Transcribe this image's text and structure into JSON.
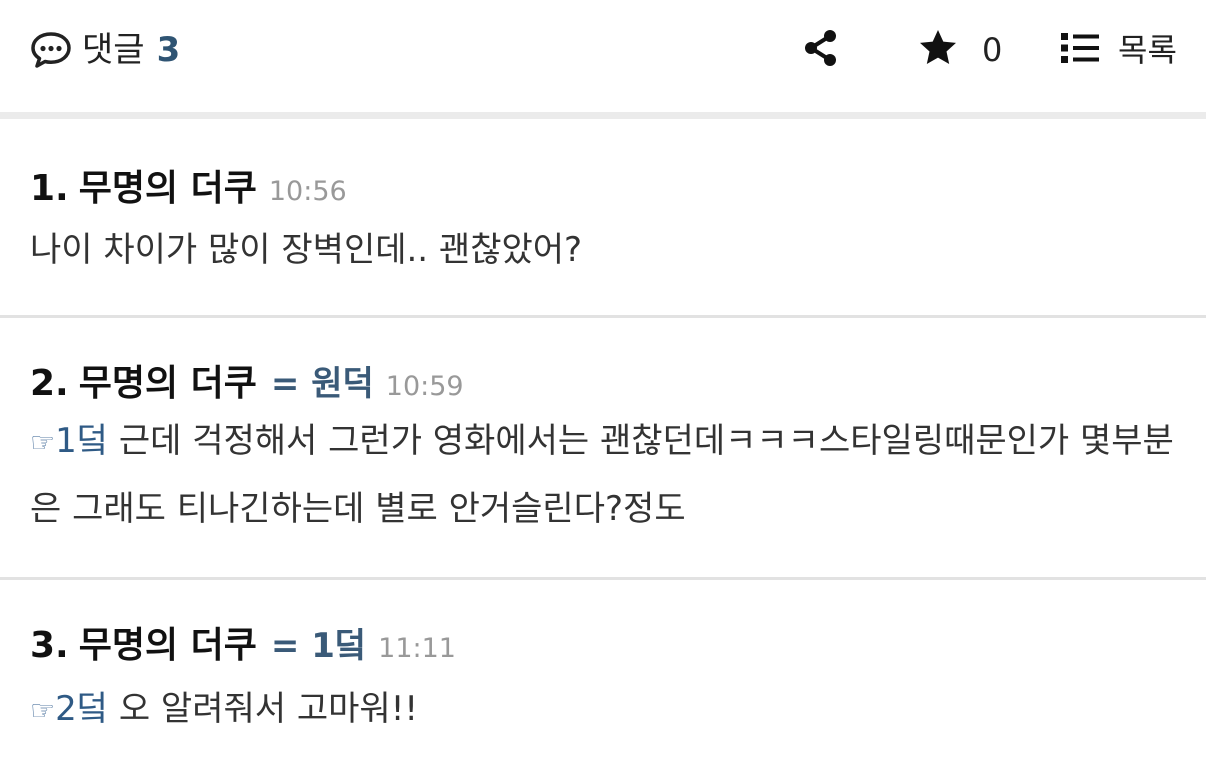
{
  "header": {
    "comments_label": "댓글",
    "comments_count": "3",
    "star_count": "0",
    "list_label": "목록",
    "accent_color": "#2f5473"
  },
  "comments": [
    {
      "number": "1.",
      "author": "무명의 더쿠",
      "reply_tag": "",
      "time": "10:56",
      "ref_hand": "",
      "ref_label": "",
      "text": "나이 차이가 많이 장벽인데.. 괜찮았어?"
    },
    {
      "number": "2.",
      "author": "무명의 더쿠",
      "reply_tag": "= 원덕",
      "time": "10:59",
      "ref_hand": "☞",
      "ref_label": "1덬",
      "text": " 근데 걱정해서 그런가 영화에서는 괜찮던데ㅋㅋㅋ스타일링때문인가 몇부분은 그래도 티나긴하는데 별로 안거슬린다?정도"
    },
    {
      "number": "3.",
      "author": "무명의 더쿠",
      "reply_tag": "= 1덬",
      "time": "11:11",
      "ref_hand": "☞",
      "ref_label": "2덬",
      "text": " 오 알려줘서 고마워!!"
    }
  ],
  "icons": {
    "comment": "speech-bubble-icon",
    "share": "share-icon",
    "star": "star-icon",
    "list": "list-icon"
  }
}
